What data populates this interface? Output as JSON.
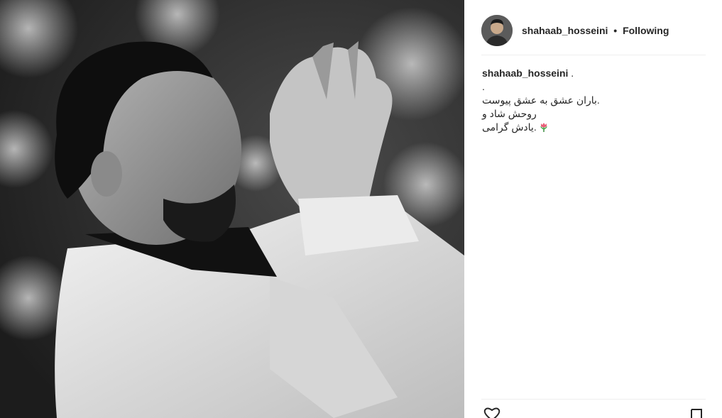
{
  "post": {
    "image_alt": "Black and white photo of a man in a white suit clapping",
    "author": {
      "username": "shahaab_hosseini",
      "separator": "•",
      "follow_status": "Following",
      "avatar_icon": "profile-avatar"
    },
    "caption": {
      "username": "shahaab_hosseini",
      "suffix": " .",
      "lines": [
        ".",
        ".باران عشق به عشق پیوست",
        "روحش شاد و",
        ".یادش گرامی"
      ],
      "emoji": "tulip-icon"
    },
    "actions": {
      "like_icon": "heart-icon",
      "save_icon": "bookmark-icon"
    }
  },
  "colors": {
    "text": "#262626",
    "divider": "#efefef",
    "tulip_pink": "#e8607a",
    "tulip_green": "#4caf50"
  }
}
